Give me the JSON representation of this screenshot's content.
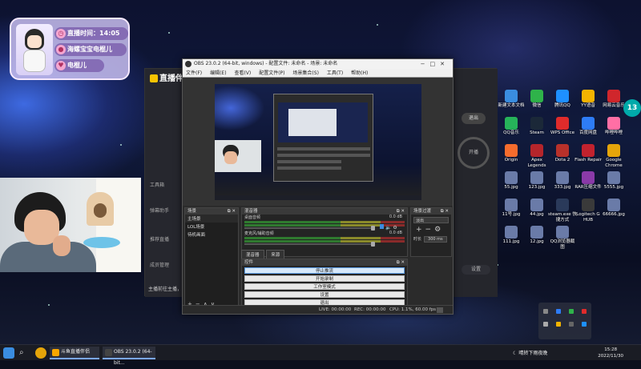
{
  "overlay": {
    "live_time_label": "直播时间：14:05",
    "line2": "海螺宝宝电棍儿",
    "line3": "电棍儿"
  },
  "zhibo": {
    "title": "直播伴",
    "side_items": [
      "工具箱",
      "弹幕助手",
      "推荐直播",
      "成员管理",
      "主播"
    ],
    "notice": "主播前往主播，抖音主播",
    "right_btn_top": "退出",
    "circle_label": "开播",
    "right_btn_bottom": "设置"
  },
  "desktop_icons": [
    {
      "label": "新建文本文档",
      "color": "#3a8de0"
    },
    {
      "label": "微信",
      "color": "#2fb34a"
    },
    {
      "label": "腾讯QQ",
      "color": "#1e90ff"
    },
    {
      "label": "YY语音",
      "color": "#f4b400"
    },
    {
      "label": "网易云音乐",
      "color": "#d0262c"
    },
    {
      "label": "QQ音乐",
      "color": "#26b35a"
    },
    {
      "label": "Steam",
      "color": "#1b2838"
    },
    {
      "label": "WPS Office",
      "color": "#e02b2b"
    },
    {
      "label": "百度网盘",
      "color": "#2e7cf6"
    },
    {
      "label": "哔哩哔哩",
      "color": "#ff6fa5"
    },
    {
      "label": "Origin",
      "color": "#f56c2d"
    },
    {
      "label": "Apex Legends",
      "color": "#b5252b"
    },
    {
      "label": "Dota 2",
      "color": "#b8312a"
    },
    {
      "label": "Flash Repair",
      "color": "#c2222e"
    },
    {
      "label": "Google Chrome",
      "color": "#e5a50a"
    },
    {
      "label": "55.jpg",
      "color": "#6a7ba8"
    },
    {
      "label": "123.jpg",
      "color": "#6a7ba8"
    },
    {
      "label": "333.jpg",
      "color": "#6a7ba8"
    },
    {
      "label": "RAR压缩文件",
      "color": "#8a3aa8"
    },
    {
      "label": "5555.jpg",
      "color": "#6a7ba8"
    },
    {
      "label": "11号.jpg",
      "color": "#6a7ba8"
    },
    {
      "label": "44.jpg",
      "color": "#6a7ba8"
    },
    {
      "label": "steam.exe 快捷方式",
      "color": "#2a3a5a"
    },
    {
      "label": "Logitech G HUB",
      "color": "#3a3a3a"
    },
    {
      "label": "66666.jpg",
      "color": "#6a7ba8"
    },
    {
      "label": "111.jpg",
      "color": "#6a7ba8"
    },
    {
      "label": "12.jpg",
      "color": "#6a7ba8"
    },
    {
      "label": "QQ浏览器截图",
      "color": "#6a7ba8"
    }
  ],
  "badge": "13",
  "obs": {
    "title": "OBS 23.0.2 (64-bit, windows) - 配置文件: 未命名 - 场景: 未命名",
    "menu": [
      "文件(F)",
      "编辑(E)",
      "查看(V)",
      "配置文件(P)",
      "场景集合(S)",
      "工具(T)",
      "帮助(H)"
    ],
    "scenes_title": "场景",
    "scenes": [
      "主场景",
      "LOL场景",
      "待机画面"
    ],
    "mixer_title": "混音器",
    "mixer_channels": [
      {
        "name": "桌面音频",
        "db": "0.0 dB"
      },
      {
        "name": "麦克风/辅助音频",
        "db": "0.0 dB"
      }
    ],
    "transition_title": "场景过渡",
    "transition_value": "淡出",
    "duration_label": "时长",
    "duration_value": "300 ms",
    "tabs": [
      "混音器",
      "来源"
    ],
    "controls_title": "控件",
    "controls": [
      "停止推流",
      "开始录制",
      "工作室模式",
      "设置",
      "退出"
    ],
    "status": {
      "live": "LIVE: 00:00:00",
      "rec": "REC: 00:00:00",
      "cpu": "CPU: 1.1%, 60.00 fps"
    }
  },
  "taskbar": {
    "tasks": [
      {
        "label": "斗鱼直播伴侣",
        "color": "#f7a600"
      },
      {
        "label": "OBS 23.0.2 (64-bit...",
        "color": "#444"
      }
    ],
    "weather": "晴转下雨夜晚",
    "time": "15:28",
    "date": "2022/11/30"
  }
}
